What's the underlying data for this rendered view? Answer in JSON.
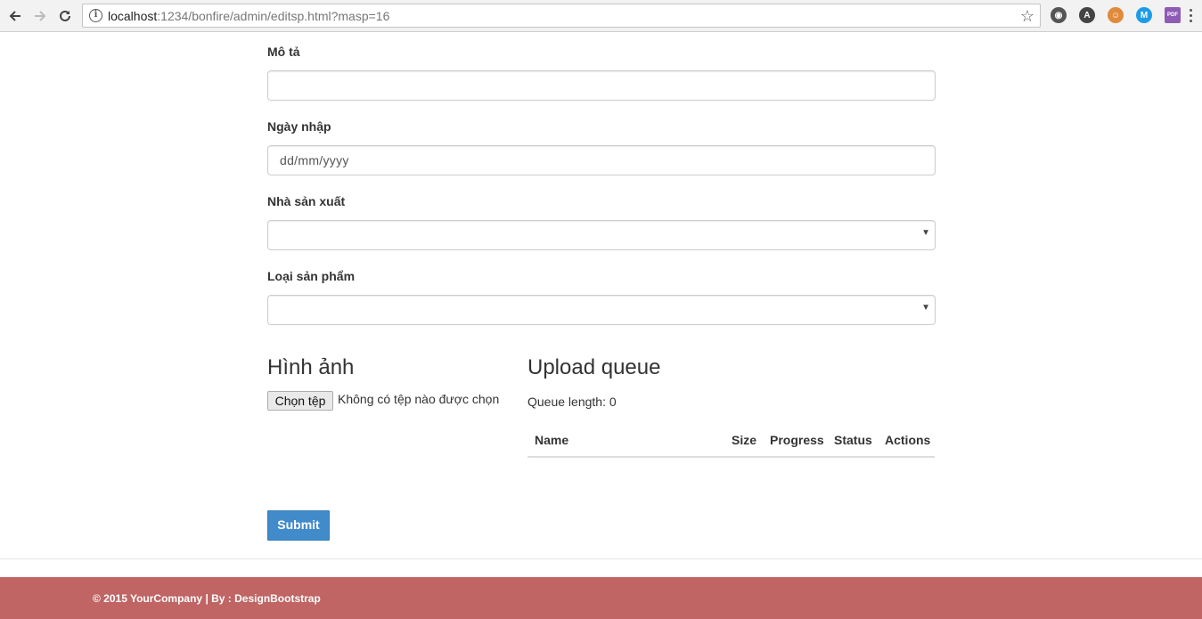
{
  "browser": {
    "url_host": "localhost",
    "url_rest": ":1234/bonfire/admin/editsp.html?masp=16",
    "extensions": [
      {
        "name": "eye-extension-icon",
        "glyph": "◉",
        "color": "#555555"
      },
      {
        "name": "a-extension-icon",
        "glyph": "A",
        "color": "#444444"
      },
      {
        "name": "face-extension-icon",
        "glyph": "☺",
        "color": "#e08a3c"
      },
      {
        "name": "m-extension-icon",
        "glyph": "M",
        "color": "#1e9be8"
      },
      {
        "name": "pdf-extension-icon",
        "glyph": "PDF",
        "color": "#8e5bb5"
      }
    ]
  },
  "form": {
    "mota_label": "Mô tả",
    "mota_value": "",
    "ngaynhap_label": "Ngày nhập",
    "ngaynhap_placeholder": "dd/mm/yyyy",
    "nhasanxuat_label": "Nhà sản xuất",
    "nhasanxuat_value": "",
    "loaisanpham_label": "Loại sản phẩm",
    "loaisanpham_value": ""
  },
  "image": {
    "heading": "Hình ảnh",
    "choose_button": "Chọn tệp",
    "no_file_text": "Không có tệp nào được chọn"
  },
  "queue": {
    "heading": "Upload queue",
    "length_text": "Queue length: 0",
    "columns": [
      "Name",
      "Size",
      "Progress",
      "Status",
      "Actions"
    ]
  },
  "submit_label": "Submit",
  "footer": {
    "text": "© 2015 YourCompany | By : DesignBootstrap",
    "color": "#c06464"
  }
}
